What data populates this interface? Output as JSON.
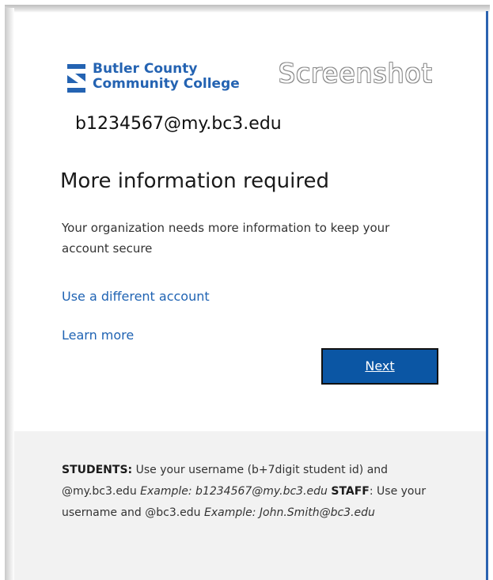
{
  "brand": {
    "name_line1": "Butler County",
    "name_line2": "Community College",
    "color": "#2463b2"
  },
  "overlay": {
    "watermark_text": "Screenshot"
  },
  "account": {
    "email": "b1234567@my.bc3.edu"
  },
  "prompt": {
    "title": "More information required",
    "description": "Your organization needs more information to keep your account secure"
  },
  "links": {
    "use_different_account": "Use a different account",
    "learn_more": "Learn more",
    "color": "#1f63b3"
  },
  "actions": {
    "next_label": "Next",
    "button_color": "#0b56a4"
  },
  "footer": {
    "students_label": "STUDENTS:",
    "students_text": " Use your username (b+7digit student id) and @my.bc3.edu ",
    "students_example": "Example: b1234567@my.bc3.edu",
    "staff_label": "STAFF",
    "staff_text": ": Use your username and @bc3.edu ",
    "staff_example": "Example: John.Smith@bc3.edu",
    "background": "#f2f2f2"
  }
}
